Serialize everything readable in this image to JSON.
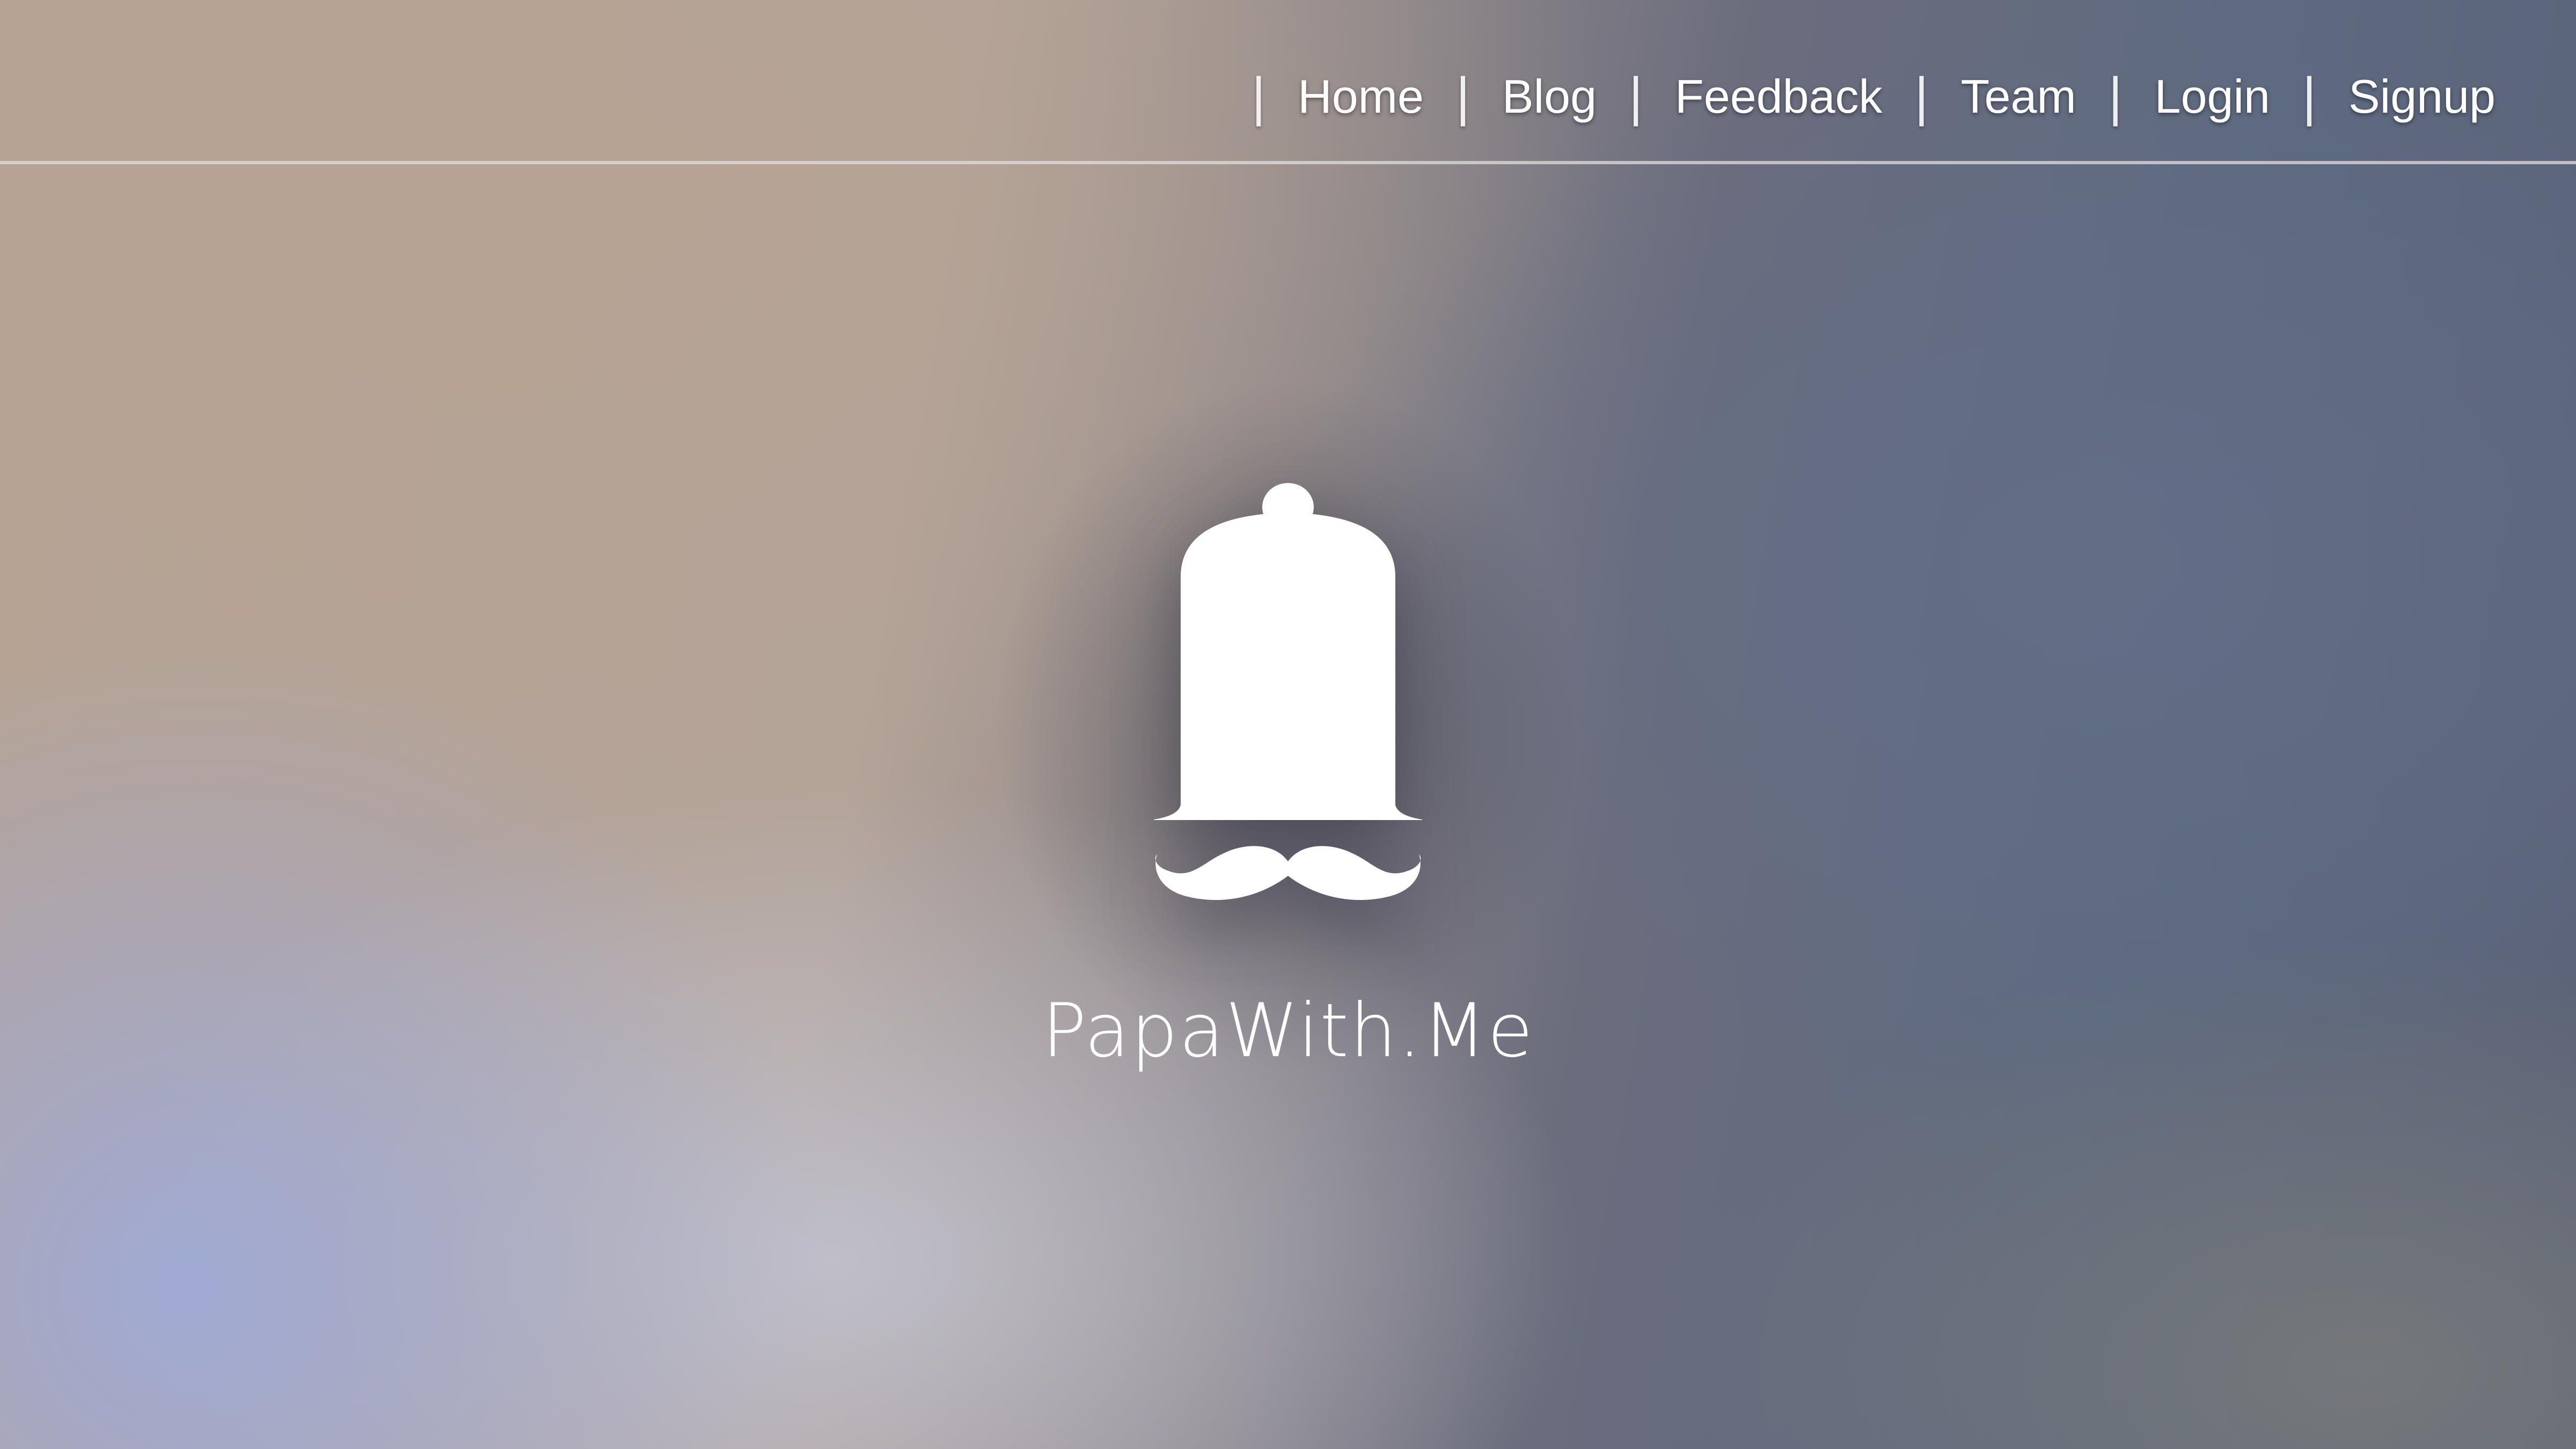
{
  "nav": {
    "items": [
      {
        "label": "Home"
      },
      {
        "label": "Blog"
      },
      {
        "label": "Feedback"
      },
      {
        "label": "Team"
      },
      {
        "label": "Login"
      },
      {
        "label": "Signup"
      }
    ],
    "separator": "|"
  },
  "brand": {
    "name": "PapaWith.Me",
    "logo_icon": "bell-mustache-icon"
  },
  "colors": {
    "text": "#ffffff",
    "background_warm": "#b6a394",
    "background_cool": "#5e6a80",
    "background_blue": "#a0aad4"
  }
}
